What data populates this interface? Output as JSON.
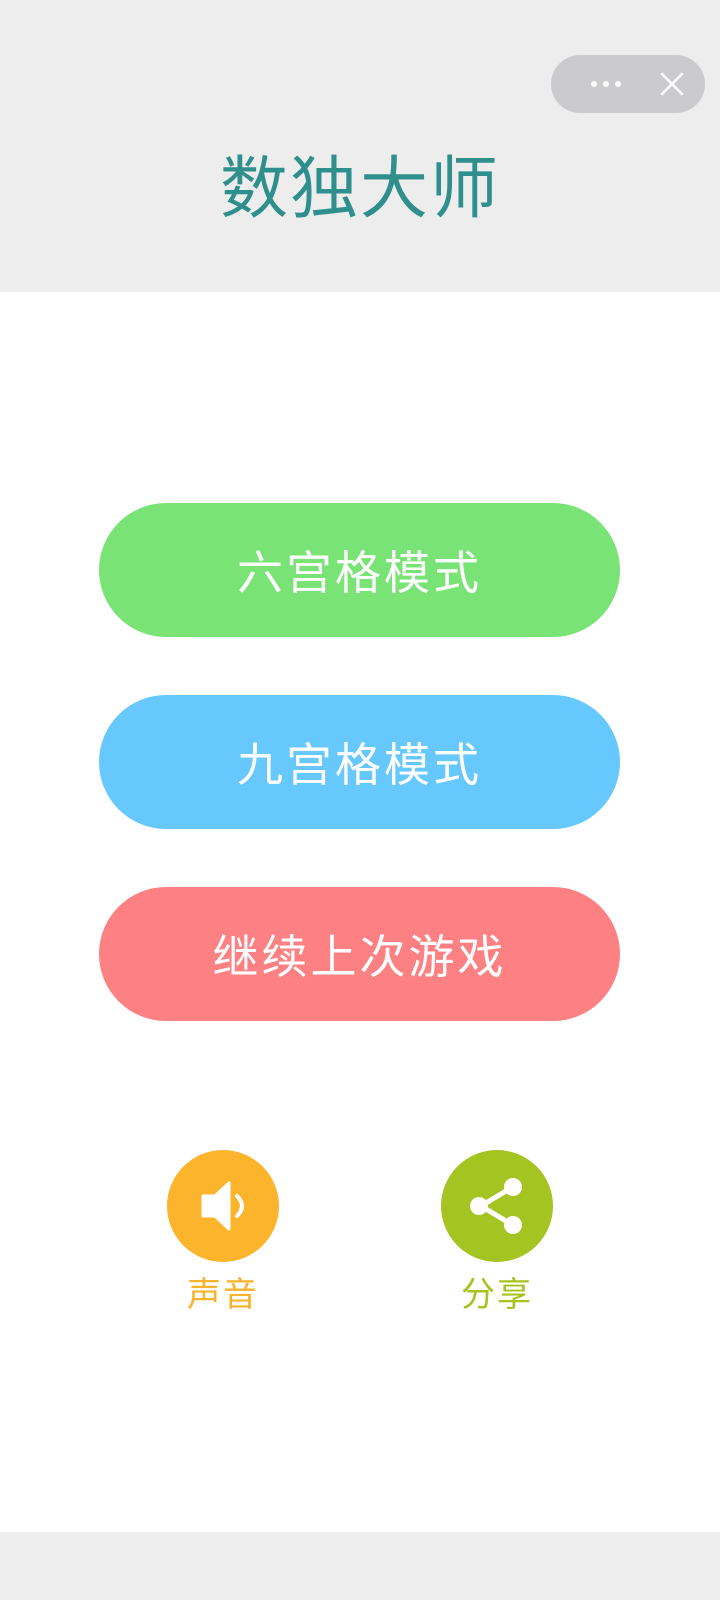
{
  "app": {
    "title": "数独大师"
  },
  "capsule": {
    "more_icon": "more-dots-icon",
    "close_icon": "close-icon"
  },
  "menu": {
    "buttons": [
      {
        "label": "六宫格模式",
        "color": "#79e475"
      },
      {
        "label": "九宫格模式",
        "color": "#66c8fd"
      },
      {
        "label": "继续上次游戏",
        "color": "#fd8182"
      }
    ]
  },
  "actions": {
    "sound": {
      "label": "声音",
      "icon": "speaker-icon",
      "color": "#fbb42c"
    },
    "share": {
      "label": "分享",
      "icon": "share-icon",
      "color": "#a4c422"
    }
  },
  "colors": {
    "title": "#2e8f8c",
    "header_bg": "#ededee"
  }
}
